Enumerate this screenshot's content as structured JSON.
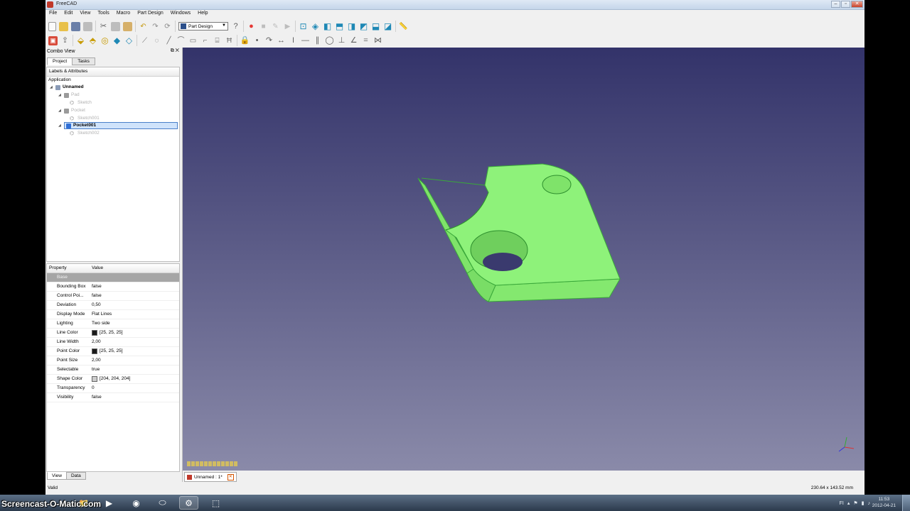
{
  "window": {
    "title": "FreeCAD"
  },
  "menu": [
    "File",
    "Edit",
    "View",
    "Tools",
    "Macro",
    "Part Design",
    "Windows",
    "Help"
  ],
  "toolbar": {
    "workbench": "Part Design"
  },
  "combo_view": {
    "title": "Combo View",
    "tabs": [
      "Project",
      "Tasks"
    ],
    "tree_header": "Labels & Attributes",
    "tree_root": "Application",
    "document": "Unnamed",
    "items": [
      {
        "label": "Pad",
        "level": 1,
        "state": "hidden"
      },
      {
        "label": "Sketch",
        "level": 2,
        "state": "hidden"
      },
      {
        "label": "Pocket",
        "level": 1,
        "state": "hidden"
      },
      {
        "label": "Sketch001",
        "level": 2,
        "state": "hidden"
      },
      {
        "label": "Pocket001",
        "level": 1,
        "state": "selected"
      },
      {
        "label": "Sketch002",
        "level": 2,
        "state": "hidden"
      }
    ]
  },
  "properties": {
    "header": {
      "property": "Property",
      "value": "Value"
    },
    "group": "Base",
    "rows": [
      {
        "name": "Bounding Box",
        "value": "false"
      },
      {
        "name": "Control Poi...",
        "value": "false"
      },
      {
        "name": "Deviation",
        "value": "0,50"
      },
      {
        "name": "Display Mode",
        "value": "Flat Lines"
      },
      {
        "name": "Lighting",
        "value": "Two side"
      },
      {
        "name": "Line Color",
        "value": "[25, 25, 25]",
        "color": "#191919"
      },
      {
        "name": "Line Width",
        "value": "2,00"
      },
      {
        "name": "Point Color",
        "value": "[25, 25, 25]",
        "color": "#191919"
      },
      {
        "name": "Point Size",
        "value": "2,00"
      },
      {
        "name": "Selectable",
        "value": "true"
      },
      {
        "name": "Shape Color",
        "value": "[204, 204, 204]",
        "color": "#cccccc"
      },
      {
        "name": "Transparency",
        "value": "0"
      },
      {
        "name": "Visibility",
        "value": "false"
      }
    ],
    "bottom_tabs": [
      "View",
      "Data"
    ]
  },
  "document_tab": "Unnamed : 1*",
  "status": {
    "left": "Valid",
    "right": "230.64 x 143.52 mm"
  },
  "taskbar": {
    "watermark": "Screencast-O-Matic.com",
    "tray_lang": "FI",
    "clock_time": "11:53",
    "clock_date": "2012-04-21"
  },
  "colors": {
    "part_green": "#8ef27a",
    "viewport_top": "#33336a",
    "viewport_bottom": "#8a8aa9",
    "selection": "#cfe3fb"
  }
}
